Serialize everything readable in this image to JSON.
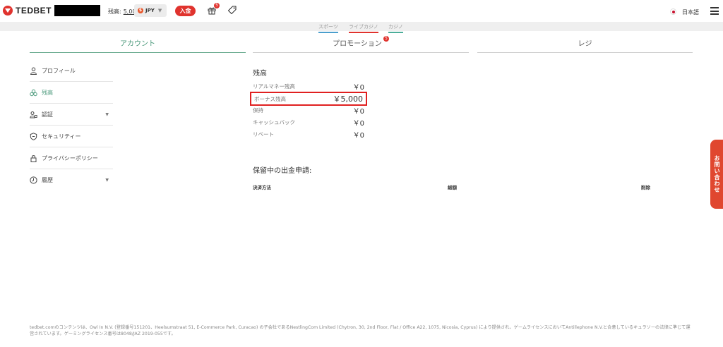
{
  "header": {
    "brand": "TEDBET",
    "balance_label": "残高:",
    "balance_value": "5,000",
    "currency_coin": "$",
    "currency": "JPY",
    "deposit_label": "入金",
    "gift_badge": "5",
    "language": "日本語"
  },
  "subnav": {
    "items": [
      "スポーツ",
      "ライブカジノ",
      "カジノ"
    ]
  },
  "tabs": {
    "account": "アカウント",
    "promotions": "プロモーション",
    "promotions_badge": "5",
    "cashier": "レジ"
  },
  "sidebar": {
    "items": [
      {
        "label": "プロフィール",
        "icon": "person-icon"
      },
      {
        "label": "残高",
        "icon": "coins-icon"
      },
      {
        "label": "認証",
        "icon": "id-icon"
      },
      {
        "label": "セキュリティー",
        "icon": "shield-icon"
      },
      {
        "label": "プライバシーポリシー",
        "icon": "lock-icon"
      },
      {
        "label": "履歴",
        "icon": "clock-icon"
      }
    ]
  },
  "balance": {
    "title": "残高",
    "rows": [
      {
        "label": "リアルマネー残高",
        "amount": "￥0"
      },
      {
        "label": "ボーナス残高",
        "amount": "￥5,000"
      },
      {
        "label": "保持",
        "amount": "￥0"
      },
      {
        "label": "キャッシュバック",
        "amount": "￥0"
      },
      {
        "label": "リベート",
        "amount": "￥0"
      }
    ]
  },
  "withdrawals": {
    "title": "保留中の出金申請:",
    "columns": [
      "決済方法",
      "総額",
      "削除"
    ]
  },
  "contact_tab": "お問い合わせ",
  "footer": "tedbet.comのコンテンツは、Owl In N.V. (登録番号151201、Heelsumstraat 51, E-Commerce Park, Curacao) の子会社であるNestlingCom Limited (Chytron, 30, 2nd Floor, Flat / Office A22, 1075, Nicosia, Cyprus) により提供され、ゲームライセンスにおいてAntillephone N.V.と合意しているキュラソーの法律に準じて運営されています。ゲーミングライセンス番号は8048/JAZ 2019-055です。",
  "colors": {
    "brand_red": "#e0332e",
    "accent_green": "#4c9a7c",
    "highlight_red": "#e02020"
  }
}
